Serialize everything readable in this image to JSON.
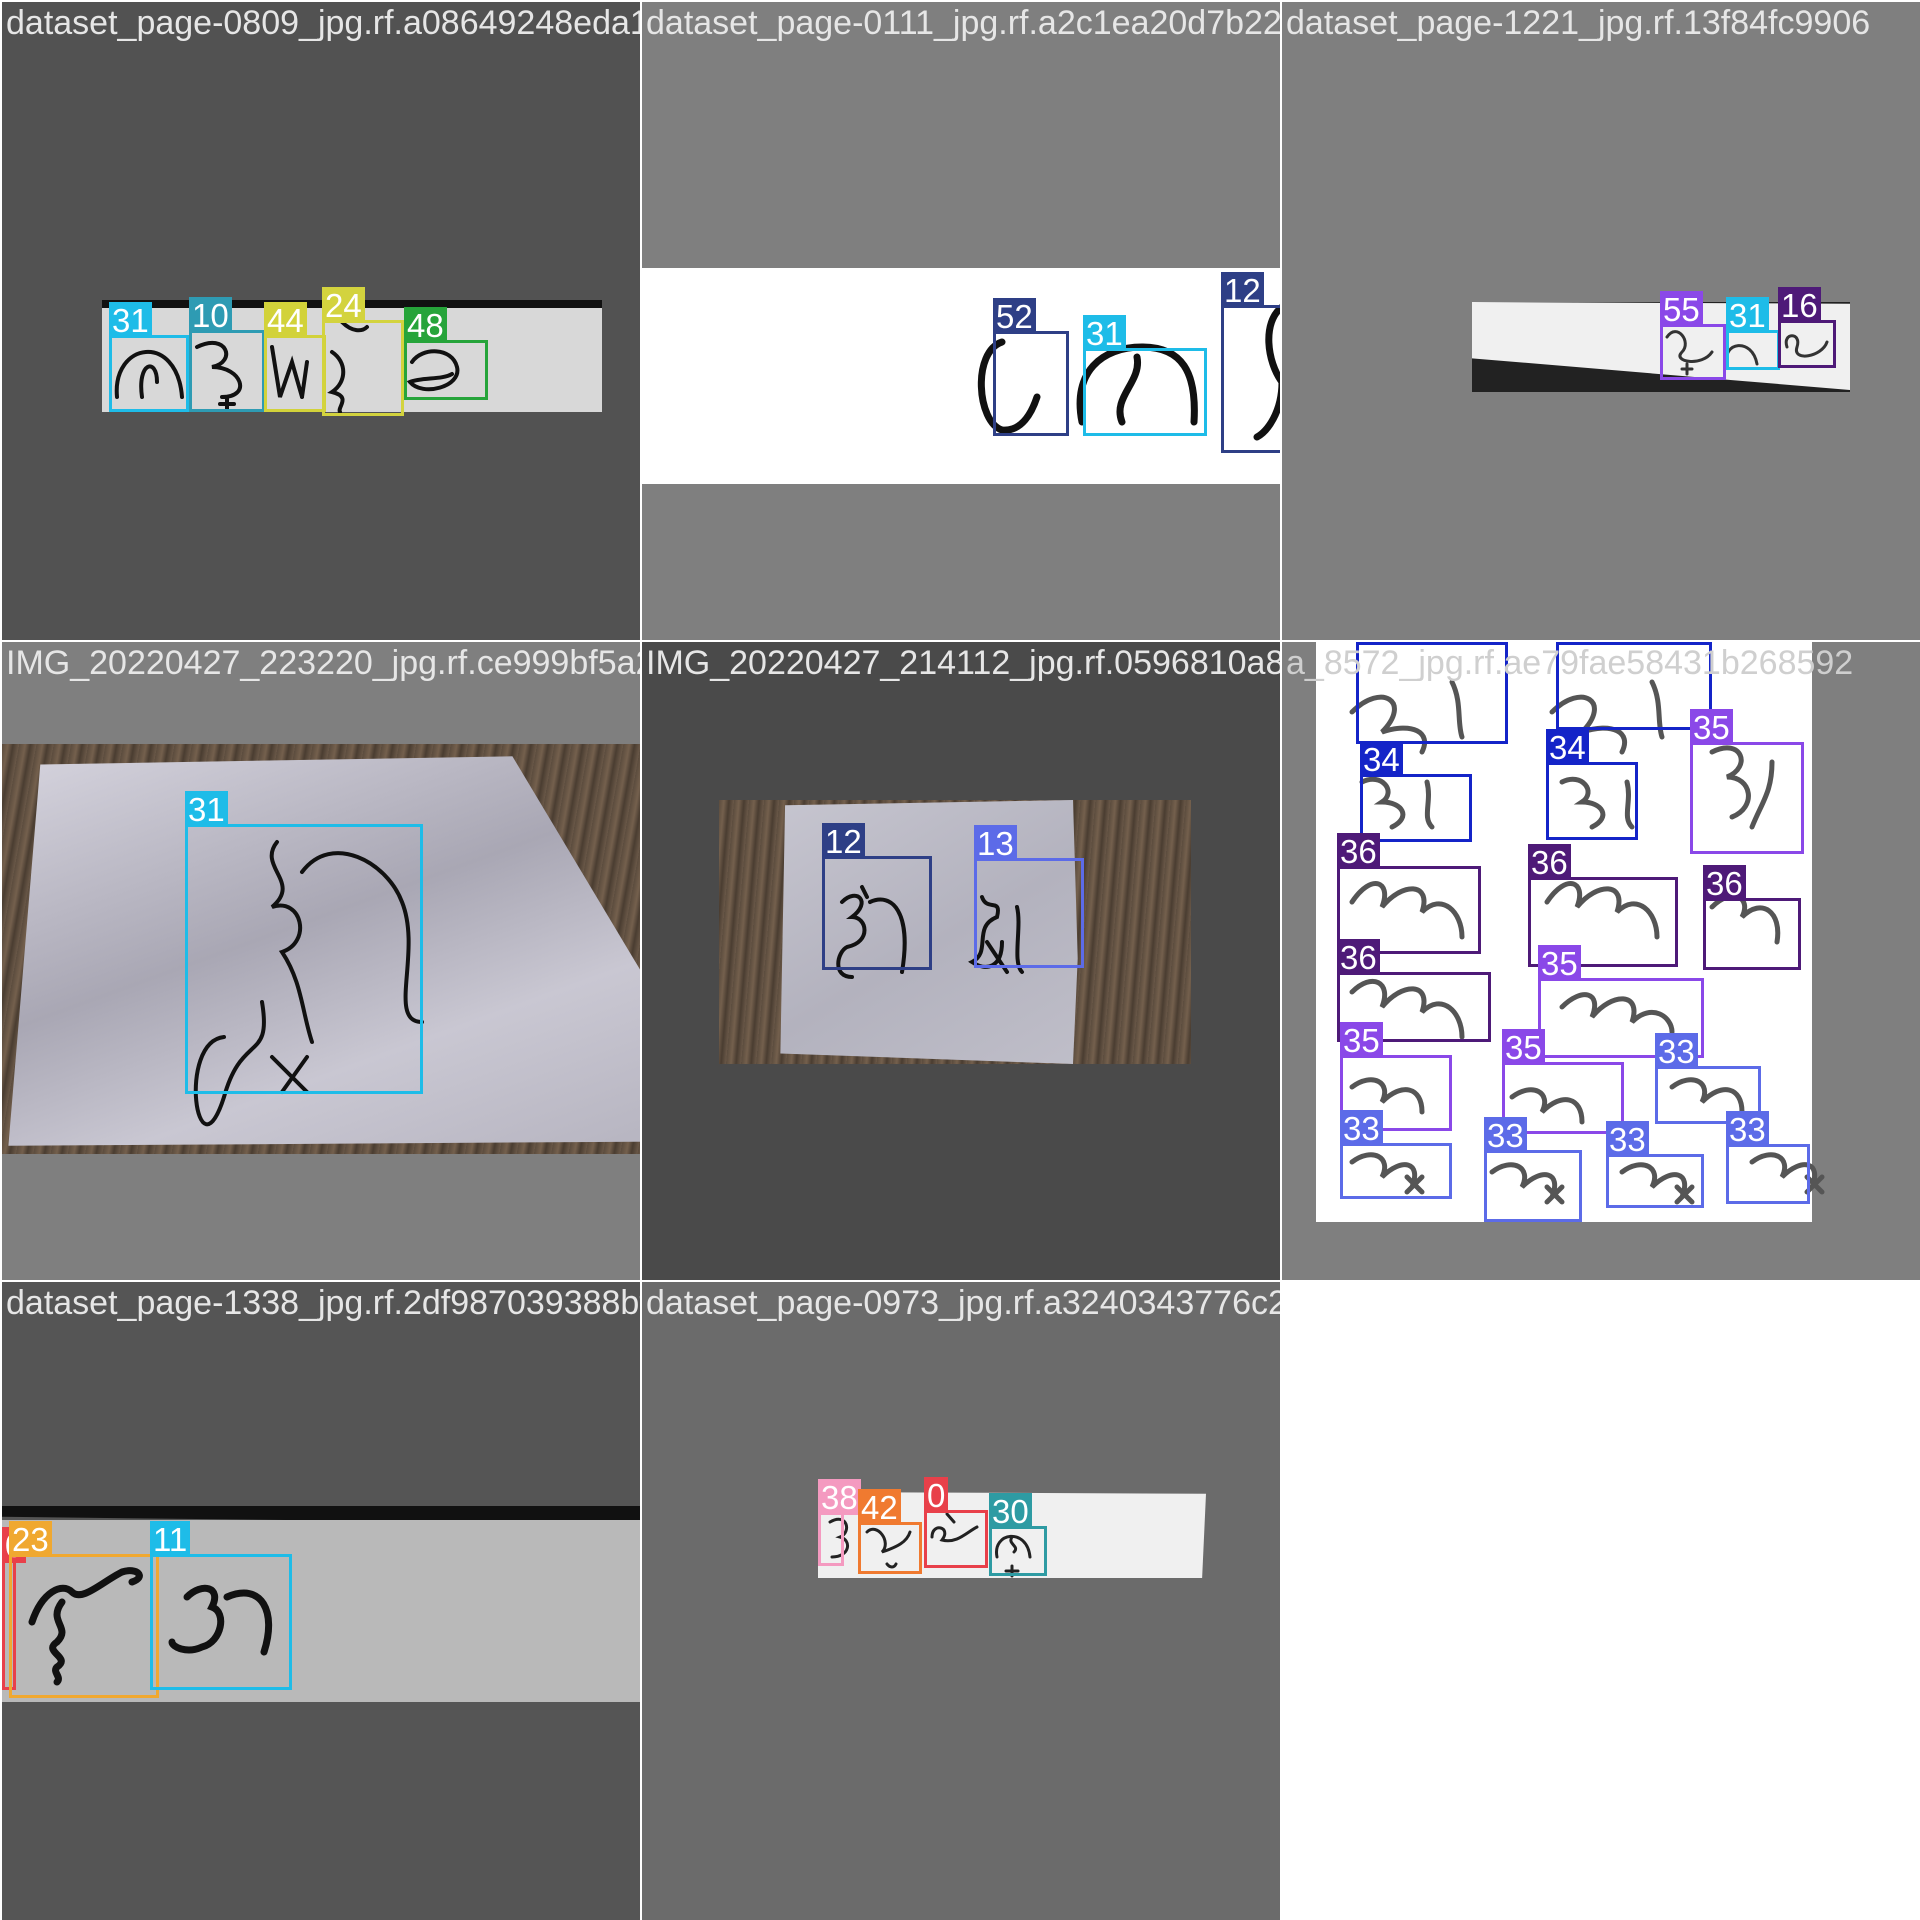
{
  "tiles": [
    {
      "title": "dataset_page-0809_jpg.rf.a08649248eda11e2",
      "boxes": [
        {
          "label": "31",
          "color": "#1ebce8"
        },
        {
          "label": "10",
          "color": "#2e9bb3"
        },
        {
          "label": "44",
          "color": "#d2d23a"
        },
        {
          "label": "24",
          "color": "#d3d33e"
        },
        {
          "label": "48",
          "color": "#26a43a"
        }
      ]
    },
    {
      "title": "dataset_page-0111_jpg.rf.a2c1ea20d7b22256",
      "boxes": [
        {
          "label": "52",
          "color": "#2e3f86"
        },
        {
          "label": "31",
          "color": "#1ebce8"
        },
        {
          "label": "12",
          "color": "#2e3f86"
        }
      ]
    },
    {
      "title": "dataset_page-1221_jpg.rf.13f84fc9906",
      "boxes": [
        {
          "label": "55",
          "color": "#8a48e8"
        },
        {
          "label": "31",
          "color": "#1ebce8"
        },
        {
          "label": "16",
          "color": "#4e1a78"
        }
      ]
    },
    {
      "title": "IMG_20220427_223220_jpg.rf.ce999bf5a201",
      "boxes": [
        {
          "label": "31",
          "color": "#1ebce8"
        }
      ]
    },
    {
      "title": "IMG_20220427_214112_jpg.rf.0596810a8f88",
      "boxes": [
        {
          "label": "12",
          "color": "#2e3f86"
        },
        {
          "label": "13",
          "color": "#5c6be8"
        }
      ]
    },
    {
      "title": "a_8572_jpg.rf.ae79fae58431b268592",
      "boxes": [
        {
          "label": "34",
          "color": "#1424c8"
        },
        {
          "label": "34",
          "color": "#1424c8"
        },
        {
          "label": "34",
          "color": "#1424c8"
        },
        {
          "label": "34",
          "color": "#1424c8"
        },
        {
          "label": "35",
          "color": "#8a48e8"
        },
        {
          "label": "36",
          "color": "#4e1a78"
        },
        {
          "label": "36",
          "color": "#4e1a78"
        },
        {
          "label": "36",
          "color": "#4e1a78"
        },
        {
          "label": "36",
          "color": "#4e1a78"
        },
        {
          "label": "35",
          "color": "#8a48e8"
        },
        {
          "label": "35",
          "color": "#8a48e8"
        },
        {
          "label": "35",
          "color": "#8a48e8"
        },
        {
          "label": "33",
          "color": "#5c6be8"
        },
        {
          "label": "33",
          "color": "#5c6be8"
        },
        {
          "label": "33",
          "color": "#5c6be8"
        },
        {
          "label": "33",
          "color": "#5c6be8"
        },
        {
          "label": "33",
          "color": "#5c6be8"
        }
      ]
    },
    {
      "title": "dataset_page-1338_jpg.rf.2df987039388bf77e",
      "boxes": [
        {
          "label": "0",
          "color": "#e8404a"
        },
        {
          "label": "23",
          "color": "#f0a830"
        },
        {
          "label": "11",
          "color": "#1ebce8"
        }
      ]
    },
    {
      "title": "dataset_page-0973_jpg.rf.a3240343776c2102",
      "boxes": [
        {
          "label": "38",
          "color": "#f49ac0"
        },
        {
          "label": "42",
          "color": "#f07a30"
        },
        {
          "label": "0",
          "color": "#e8404a"
        },
        {
          "label": "30",
          "color": "#2e9ba3"
        }
      ]
    }
  ]
}
